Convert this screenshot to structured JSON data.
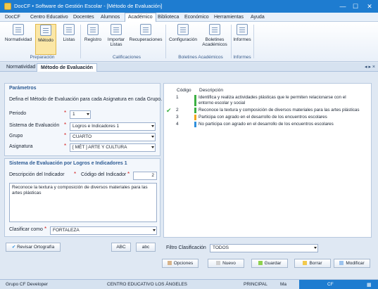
{
  "titlebar": {
    "title": "DocCF • Software de Gestión Escolar - [Método de Evaluación]"
  },
  "menu": [
    "DocCF",
    "Centro Educativo",
    "Docentes",
    "Alumnos",
    "Académico",
    "Biblioteca",
    "Económico",
    "Herramientas",
    "Ayuda"
  ],
  "menu_active": "Académico",
  "ribbon": {
    "buttons": [
      "Normatividad",
      "Método",
      "Listas",
      "Registro",
      "Importar Listas",
      "Recuperaciones",
      "Configuración",
      "Boletines Académicos",
      "Informes"
    ],
    "groups": [
      "Preparación",
      "Calificaciones",
      "Boletines Académicos",
      "Informes"
    ]
  },
  "doctabs": [
    "Normatividad",
    "Método de Evaluación"
  ],
  "tabnav": "◂ ▸ ×",
  "params": {
    "heading": "Parámetros",
    "desc": "Defina el Método de Evaluación para cada Asignatura en cada Grupo.",
    "periodo_label": "Periodo",
    "periodo_value": "1",
    "sistema_label": "Sistema de Evaluación",
    "sistema_value": "Logros e Indicadores 1",
    "grupo_label": "Grupo",
    "grupo_value": "CUARTO",
    "asignatura_label": "Asignatura",
    "asignatura_value": "[ MÉT ] ARTE Y CULTURA"
  },
  "sistema": {
    "heading": "Sistema de Evaluación por Logros e Indicadores 1",
    "desc_label": "Descripción del Indicador",
    "code_label": "Código del Indicador",
    "code_value": "2",
    "text_value": "Reconoce la textura y composición de diversos materiales para las artes plásticas",
    "clasificar_label": "Clasificar como",
    "clasificar_value": "FORTALEZA"
  },
  "bottom_left": {
    "spell": "Revisar Ortografía",
    "upper": "ABC",
    "lower": "abc"
  },
  "grid": {
    "col_code": "Código",
    "col_desc": "Descripción",
    "rows": [
      {
        "code": "1",
        "desc": "Identifica y realiza actividades plásticas que le permiten relacionarse con el entorno escolar y social",
        "color": "#3cb043",
        "checked": false
      },
      {
        "code": "2",
        "desc": "Reconoce la textura y composición de diversos materiales para las artes plásticas",
        "color": "#3cb043",
        "checked": true
      },
      {
        "code": "3",
        "desc": "Participa con agrado en el desarrollo de los encuentros escolares",
        "color": "#f2a51a",
        "checked": false
      },
      {
        "code": "4",
        "desc": "No participa con agrado en el desarrollo de los encuentros escolares",
        "color": "#2f8fdc",
        "checked": false
      }
    ]
  },
  "filtro": {
    "label": "Filtro Clasificación",
    "value": "TODOS"
  },
  "actions": [
    {
      "label": "Opciones",
      "color": "#d7b48c"
    },
    {
      "label": "Nuevo",
      "color": "#d0d0d0"
    },
    {
      "label": "Guardar",
      "color": "#8fd14f"
    },
    {
      "label": "Borrar",
      "color": "#f2c94c"
    },
    {
      "label": "Modificar",
      "color": "#9cc3ee"
    }
  ],
  "status": {
    "user": "Grupo CF Developer",
    "school": "CENTRO EDUCATIVO LOS ÁNGELES",
    "sede": "PRINCIPAL",
    "mode": "Ma",
    "brand": "CF"
  }
}
